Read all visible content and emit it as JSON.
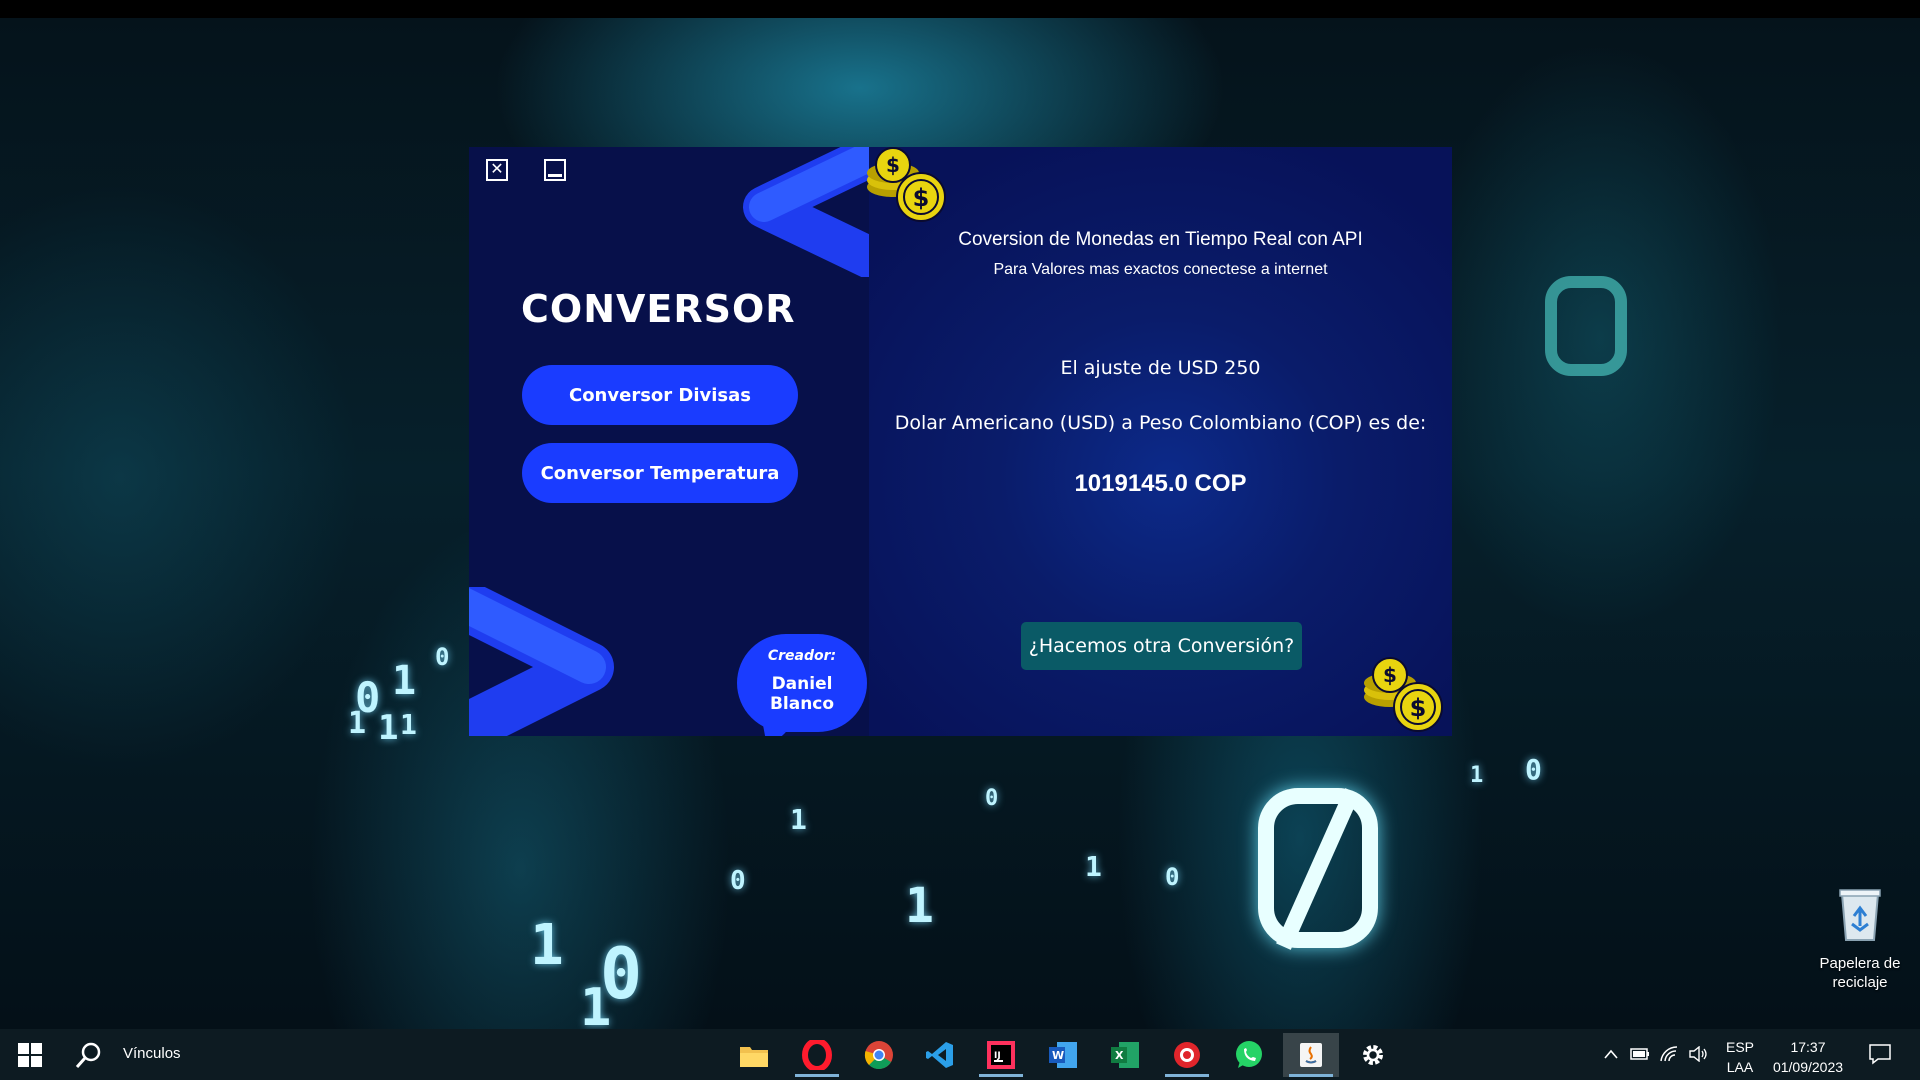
{
  "app": {
    "close_glyph": "✕",
    "logo": "CONVERSOR",
    "nav": [
      "Conversor Divisas",
      "Conversor Temperatura"
    ],
    "creator_label": "Creador:",
    "creator_name": "Daniel Blanco",
    "title": "Coversion de Monedas en Tiempo Real con API",
    "subtitle": "Para Valores mas exactos conectese a internet",
    "line1": "El ajuste de USD 250",
    "line2": "Dolar Americano (USD) a Peso Colombiano (COP) es de:",
    "result": "1019145.0 COP",
    "again_button": "¿Hacemos otra Conversión?",
    "colors": {
      "sidebar": "#07104a",
      "accent": "#1a3cff",
      "main": "#0a1c6a",
      "again": "#0a5a66"
    }
  },
  "desktop": {
    "recycle_bin_label": "Papelera de reciclaje",
    "matrix_digits": [
      "0",
      "1",
      "1",
      "1",
      "1",
      "0",
      "1",
      "0",
      "1",
      "1",
      "0",
      "1",
      "1",
      "0",
      "0",
      "1",
      "0"
    ]
  },
  "taskbar": {
    "search_label": "Vínculos",
    "apps": [
      "file-explorer-icon",
      "opera-icon",
      "chrome-icon",
      "vscode-icon",
      "intellij-icon",
      "word-icon",
      "excel-icon",
      "screen-recorder-icon",
      "whatsapp-icon",
      "java-icon",
      "settings-icon"
    ],
    "lang_top": "ESP",
    "lang_bottom": "LAA",
    "time": "17:37",
    "date": "01/09/2023"
  }
}
